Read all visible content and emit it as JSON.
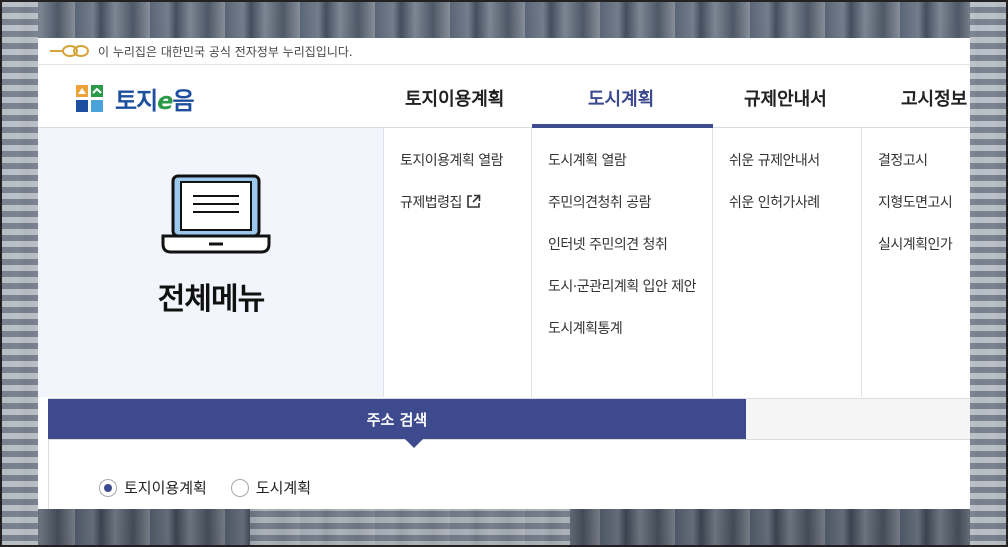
{
  "gov_bar": {
    "text": "이 누리집은 대한민국 공식 전자정부 누리집입니다.",
    "logo_icon": "egov-logo-icon"
  },
  "header": {
    "logo_text_pre": "토지",
    "logo_text_e": "e",
    "logo_text_post": "음",
    "nav": [
      {
        "label": "토지이용계획",
        "active": false
      },
      {
        "label": "도시계획",
        "active": true
      },
      {
        "label": "규제안내서",
        "active": false
      },
      {
        "label": "고시정보",
        "active": false
      }
    ]
  },
  "mega_menu": {
    "all_menu_label": "전체메뉴",
    "columns": [
      {
        "items": [
          "토지이용계획 열람",
          "규제법령집"
        ]
      },
      {
        "items": [
          "도시계획 열람",
          "주민의견청취 공람",
          "인터넷 주민의견 청취",
          "도시·군관리계획 입안 제안",
          "도시계획통계"
        ]
      },
      {
        "items": [
          "쉬운 규제안내서",
          "쉬운 인허가사례"
        ]
      },
      {
        "items": [
          "결정고시",
          "지형도면고시",
          "실시계획인가"
        ]
      }
    ]
  },
  "search": {
    "tab_label": "주소 검색",
    "radio_options": [
      {
        "label": "토지이용계획",
        "checked": true
      },
      {
        "label": "도시계획",
        "checked": false
      }
    ]
  },
  "colors": {
    "accent": "#3d4a8e",
    "logo_blue": "#1d4f9e",
    "logo_green": "#2b9a48",
    "mega_bg": "#f2f6fc"
  }
}
